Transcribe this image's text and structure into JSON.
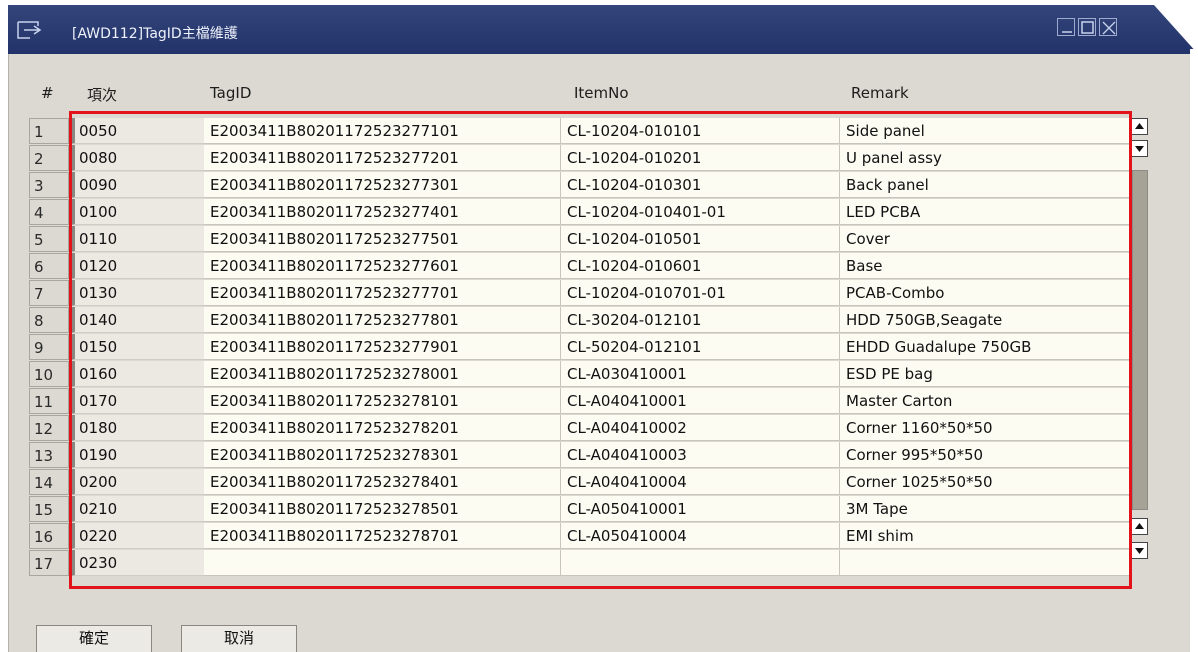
{
  "window": {
    "title": "[AWD112]TagID主檔維護",
    "title_bar_color": "#2a3a6e"
  },
  "table": {
    "columns": [
      "#",
      "項次",
      "TagID",
      "ItemNo",
      "Remark"
    ],
    "rows": [
      {
        "num": "1",
        "seq": "0050",
        "tag": "E2003411B80201172523277101",
        "item": "CL-10204-010101",
        "remark": "Side panel"
      },
      {
        "num": "2",
        "seq": "0080",
        "tag": "E2003411B80201172523277201",
        "item": "CL-10204-010201",
        "remark": "U panel assy"
      },
      {
        "num": "3",
        "seq": "0090",
        "tag": "E2003411B80201172523277301",
        "item": "CL-10204-010301",
        "remark": "Back panel"
      },
      {
        "num": "4",
        "seq": "0100",
        "tag": "E2003411B80201172523277401",
        "item": "CL-10204-010401-01",
        "remark": "LED PCBA"
      },
      {
        "num": "5",
        "seq": "0110",
        "tag": "E2003411B80201172523277501",
        "item": "CL-10204-010501",
        "remark": "Cover"
      },
      {
        "num": "6",
        "seq": "0120",
        "tag": "E2003411B80201172523277601",
        "item": "CL-10204-010601",
        "remark": "Base"
      },
      {
        "num": "7",
        "seq": "0130",
        "tag": "E2003411B80201172523277701",
        "item": "CL-10204-010701-01",
        "remark": "PCAB-Combo"
      },
      {
        "num": "8",
        "seq": "0140",
        "tag": "E2003411B80201172523277801",
        "item": "CL-30204-012101",
        "remark": "HDD 750GB,Seagate"
      },
      {
        "num": "9",
        "seq": "0150",
        "tag": "E2003411B80201172523277901",
        "item": "CL-50204-012101",
        "remark": "EHDD Guadalupe 750GB"
      },
      {
        "num": "10",
        "seq": "0160",
        "tag": "E2003411B80201172523278001",
        "item": "CL-A030410001",
        "remark": "ESD PE bag"
      },
      {
        "num": "11",
        "seq": "0170",
        "tag": "E2003411B80201172523278101",
        "item": "CL-A040410001",
        "remark": "Master Carton"
      },
      {
        "num": "12",
        "seq": "0180",
        "tag": "E2003411B80201172523278201",
        "item": "CL-A040410002",
        "remark": "Corner 1160*50*50"
      },
      {
        "num": "13",
        "seq": "0190",
        "tag": "E2003411B80201172523278301",
        "item": "CL-A040410003",
        "remark": "Corner 995*50*50"
      },
      {
        "num": "14",
        "seq": "0200",
        "tag": "E2003411B80201172523278401",
        "item": "CL-A040410004",
        "remark": "Corner 1025*50*50"
      },
      {
        "num": "15",
        "seq": "0210",
        "tag": "E2003411B80201172523278501",
        "item": "CL-A050410001",
        "remark": "3M Tape"
      },
      {
        "num": "16",
        "seq": "0220",
        "tag": "E2003411B80201172523278701",
        "item": "CL-A050410004",
        "remark": "EMI shim"
      },
      {
        "num": "17",
        "seq": "0230",
        "tag": "",
        "item": "",
        "remark": ""
      }
    ]
  },
  "buttons": {
    "confirm": "確定",
    "cancel": "取消"
  },
  "highlight_color": "#e3131b"
}
